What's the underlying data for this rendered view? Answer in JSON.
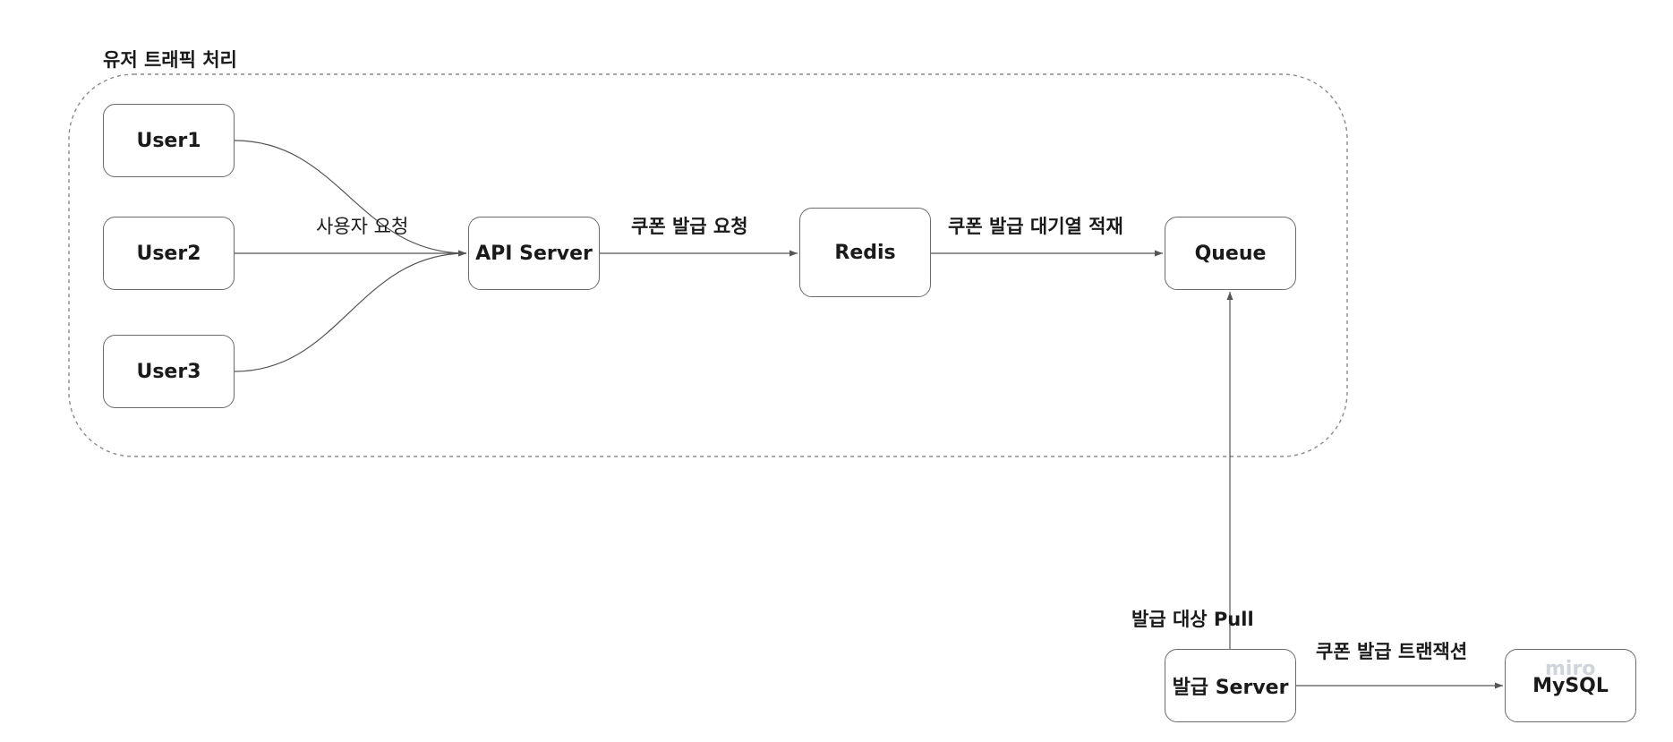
{
  "group": {
    "label": "유저 트래픽 처리"
  },
  "nodes": {
    "user1": "User1",
    "user2": "User2",
    "user3": "User3",
    "api_server": "API Server",
    "redis": "Redis",
    "queue": "Queue",
    "issue_server": "발급 Server",
    "mysql": "MySQL"
  },
  "edges": {
    "user_request": "사용자 요청",
    "coupon_request": "쿠폰 발급 요청",
    "enqueue": "쿠폰 발급 대기열 적재",
    "pull": "발급 대상 Pull",
    "transaction": "쿠폰 발급 트랜잭션"
  },
  "watermark": "miro",
  "colors": {
    "stroke": "#555555",
    "group_border": "#8a8a8a"
  }
}
